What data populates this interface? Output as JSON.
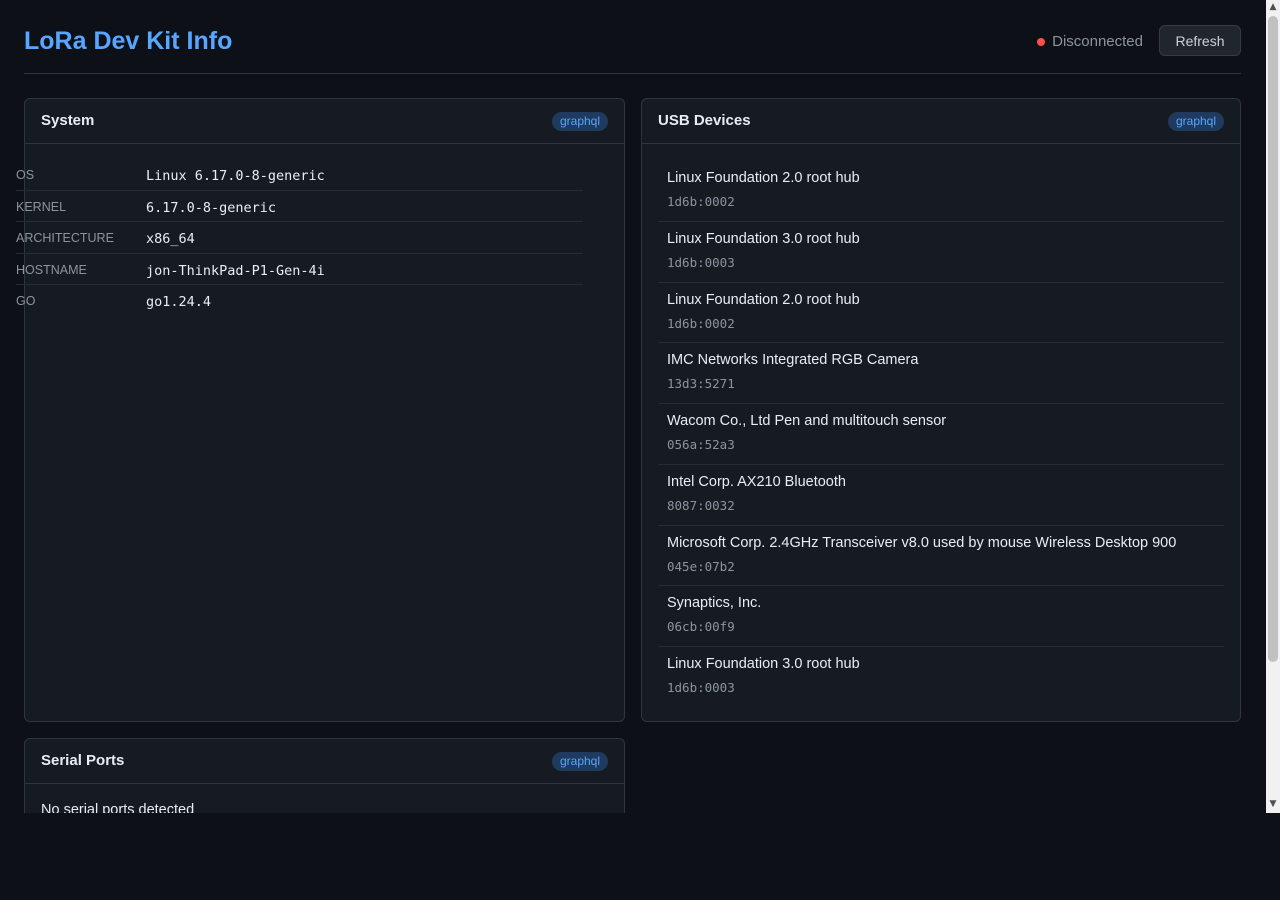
{
  "header": {
    "title": "LoRa Dev Kit Info",
    "status_text": "Disconnected",
    "status_color": "#f85149",
    "refresh_label": "Refresh"
  },
  "system": {
    "title": "System",
    "badge": "graphql",
    "rows": [
      {
        "key": "OS",
        "value": "Linux 6.17.0-8-generic"
      },
      {
        "key": "KERNEL",
        "value": "6.17.0-8-generic"
      },
      {
        "key": "ARCHITECTURE",
        "value": "x86_64"
      },
      {
        "key": "HOSTNAME",
        "value": "jon-ThinkPad-P1-Gen-4i"
      },
      {
        "key": "GO",
        "value": "go1.24.4"
      }
    ]
  },
  "usb": {
    "title": "USB Devices",
    "badge": "graphql",
    "devices": [
      {
        "name": "Linux Foundation 2.0 root hub",
        "id": "1d6b:0002"
      },
      {
        "name": "Linux Foundation 3.0 root hub",
        "id": "1d6b:0003"
      },
      {
        "name": "Linux Foundation 2.0 root hub",
        "id": "1d6b:0002"
      },
      {
        "name": "IMC Networks Integrated RGB Camera",
        "id": "13d3:5271"
      },
      {
        "name": "Wacom Co., Ltd Pen and multitouch sensor",
        "id": "056a:52a3"
      },
      {
        "name": "Intel Corp. AX210 Bluetooth",
        "id": "8087:0032"
      },
      {
        "name": "Microsoft Corp. 2.4GHz Transceiver v8.0 used by mouse Wireless Desktop 900",
        "id": "045e:07b2"
      },
      {
        "name": "Synaptics, Inc.",
        "id": "06cb:00f9"
      },
      {
        "name": "Linux Foundation 3.0 root hub",
        "id": "1d6b:0003"
      }
    ]
  },
  "serial": {
    "title": "Serial Ports",
    "badge": "graphql",
    "empty_text": "No serial ports detected"
  },
  "colors": {
    "accent": "#58a6ff",
    "background": "#0d1117",
    "card": "#161b22"
  }
}
